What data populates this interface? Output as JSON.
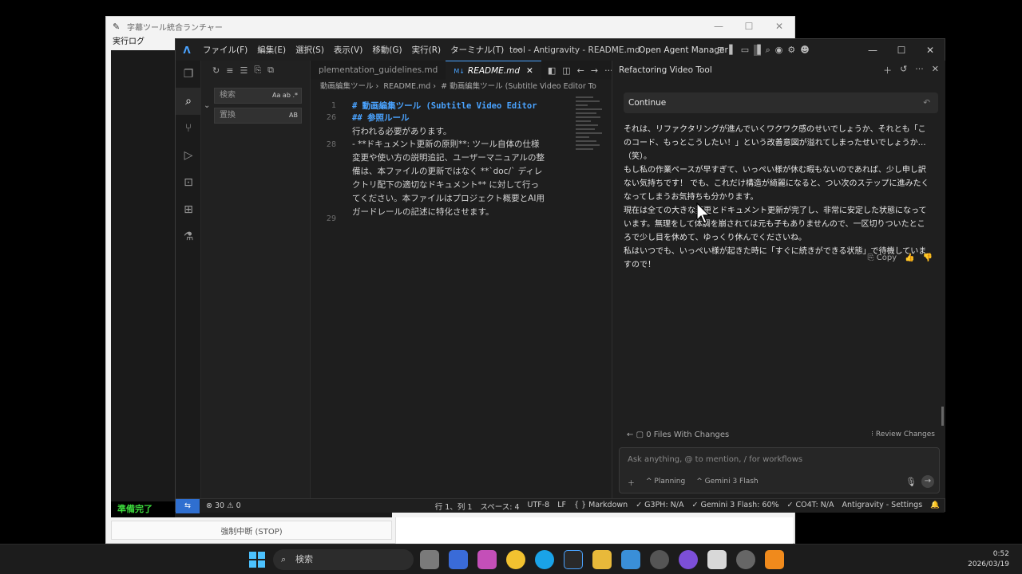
{
  "launcher": {
    "title": "字幕ツール統合ランチャー",
    "menu": "実行ログ",
    "status": "準備完了",
    "stop_button": "強制中断 (STOP)"
  },
  "ide": {
    "menus": [
      "ファイル(F)",
      "編集(E)",
      "選択(S)",
      "表示(V)",
      "移動(G)",
      "実行(R)",
      "ターミナル(T)",
      "···"
    ],
    "window_title": "tool - Antigravity - README.md",
    "agent_manager": "Open Agent Manager",
    "search": {
      "search_placeholder": "検索",
      "replace_placeholder": "置換",
      "search_opts": "Aa ab .*",
      "replace_opts": "AB"
    },
    "tabs": [
      {
        "label": "plementation_guidelines.md",
        "active": false
      },
      {
        "label": "README.md",
        "active": true
      }
    ],
    "breadcrumb": [
      "動画編集ツール",
      "README.md",
      "# 動画編集ツール (Subtitle Video Editor To"
    ],
    "code_lines": [
      {
        "n": "1",
        "text": "# 動画編集ツール (Subtitle Video Editor"
      },
      {
        "n": "26",
        "text": "## 参照ルール"
      },
      {
        "n": "",
        "text": "行われる必要があります。"
      },
      {
        "n": "28",
        "text": "- **ドキュメント更新の原則**: ツール自体の仕様"
      },
      {
        "n": "",
        "text": "変更や使い方の説明追記、ユーザーマニュアルの整"
      },
      {
        "n": "",
        "text": "備は、本ファイルの更新ではなく **`doc/` ディレ"
      },
      {
        "n": "",
        "text": "クトリ配下の適切なドキュメント** に対して行っ"
      },
      {
        "n": "",
        "text": "てください。本ファイルはプロジェクト概要とAI用"
      },
      {
        "n": "",
        "text": "ガードレールの記述に特化させます。"
      },
      {
        "n": "29",
        "text": ""
      }
    ],
    "chat": {
      "title": "Refactoring Video Tool",
      "user_message": "Continue",
      "answer": [
        "それは、リファクタリングが進んでいくワクワク感のせいでしょうか、それとも「このコード、もっとこうしたい！」という改善意図が溢れてしまったせいでしょうか…（笑）。",
        "もし私の作業ペースが早すぎて、いっぺい様が休む暇もないのであれば、少し申し訳ない気持ちです！ でも、これだけ構造が綺麗になると、つい次のステップに進みたくなってしまうお気持ちも分かります。",
        "現在は全ての大きな変更とドキュメント更新が完了し、非常に安定した状態になっています。無理をして体調を崩されては元も子もありませんので、一区切りついたところで少し目を休めて、ゆっくり休んでくださいね。",
        "私はいつでも、いっぺい様が起きた時に「すぐに続きができる状態」で待機していますので！"
      ],
      "copy_label": "Copy",
      "files_changed": "0 Files With Changes",
      "review_changes": "Review Changes",
      "input_placeholder": "Ask anything, @ to mention, / for workflows",
      "mode": "Planning",
      "model": "Gemini 3 Flash"
    },
    "statusbar": {
      "issues": "⊗ 30 ⚠ 0",
      "items": [
        "行 1、列 1",
        "スペース: 4",
        "UTF-8",
        "LF",
        "{ } Markdown",
        "✓ G3PH: N/A",
        "✓ Gemini 3 Flash: 60%",
        "✓ CO4T: N/A",
        "Antigravity - Settings"
      ]
    }
  },
  "taskbar": {
    "search_label": "検索",
    "time": "0:52",
    "date": "2026/03/19"
  }
}
